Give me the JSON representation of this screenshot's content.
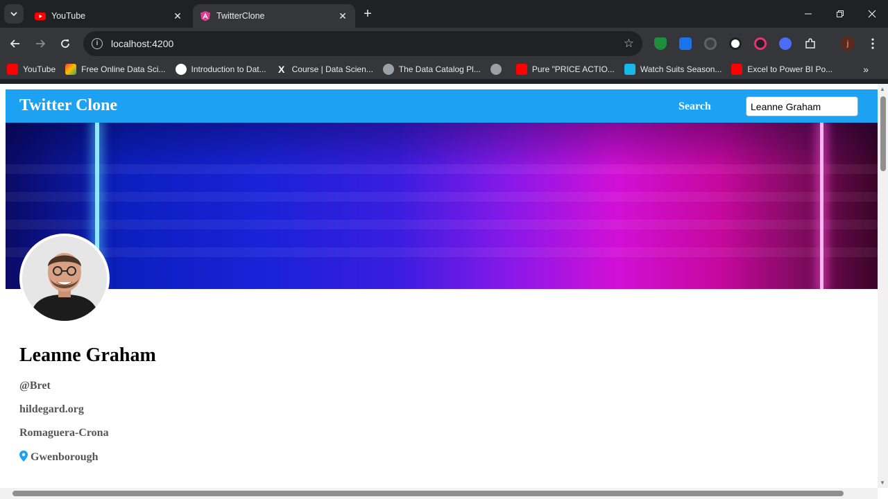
{
  "browser": {
    "tabs": [
      {
        "title": "YouTube",
        "active": false,
        "favicon": "youtube-icon"
      },
      {
        "title": "TwitterClone",
        "active": true,
        "favicon": "angular-icon"
      }
    ],
    "url": "localhost:4200",
    "profile_initial": "j",
    "bookmarks": [
      {
        "label": "YouTube",
        "icon": "youtube-icon",
        "color": "#ff0000"
      },
      {
        "label": "Free Online Data Sci...",
        "icon": "colorful-icon",
        "color": "#f4b400"
      },
      {
        "label": "Introduction to Dat...",
        "icon": "google-icon",
        "color": "#ffffff"
      },
      {
        "label": "Course | Data Scien...",
        "icon": "x-icon",
        "color": "#ffffff"
      },
      {
        "label": "The Data Catalog Pl...",
        "icon": "skull-icon",
        "color": "#9aa0a6"
      },
      {
        "label": "",
        "icon": "globe-icon",
        "color": "#9aa0a6"
      },
      {
        "label": "Pure \"PRICE ACTIO...",
        "icon": "youtube-icon",
        "color": "#ff0000"
      },
      {
        "label": "Watch Suits Season...",
        "icon": "s-icon",
        "color": "#1ab7ea"
      },
      {
        "label": "Excel to Power BI Po...",
        "icon": "youtube-icon",
        "color": "#ff0000"
      }
    ]
  },
  "app": {
    "brand": "Twitter Clone",
    "search_label": "Search",
    "search_value": "Leanne Graham",
    "accent": "#1da1f2"
  },
  "profile": {
    "name": "Leanne Graham",
    "username": "@Bret",
    "website": "hildegard.org",
    "company": "Romaguera-Crona",
    "city": "Gwenborough"
  }
}
